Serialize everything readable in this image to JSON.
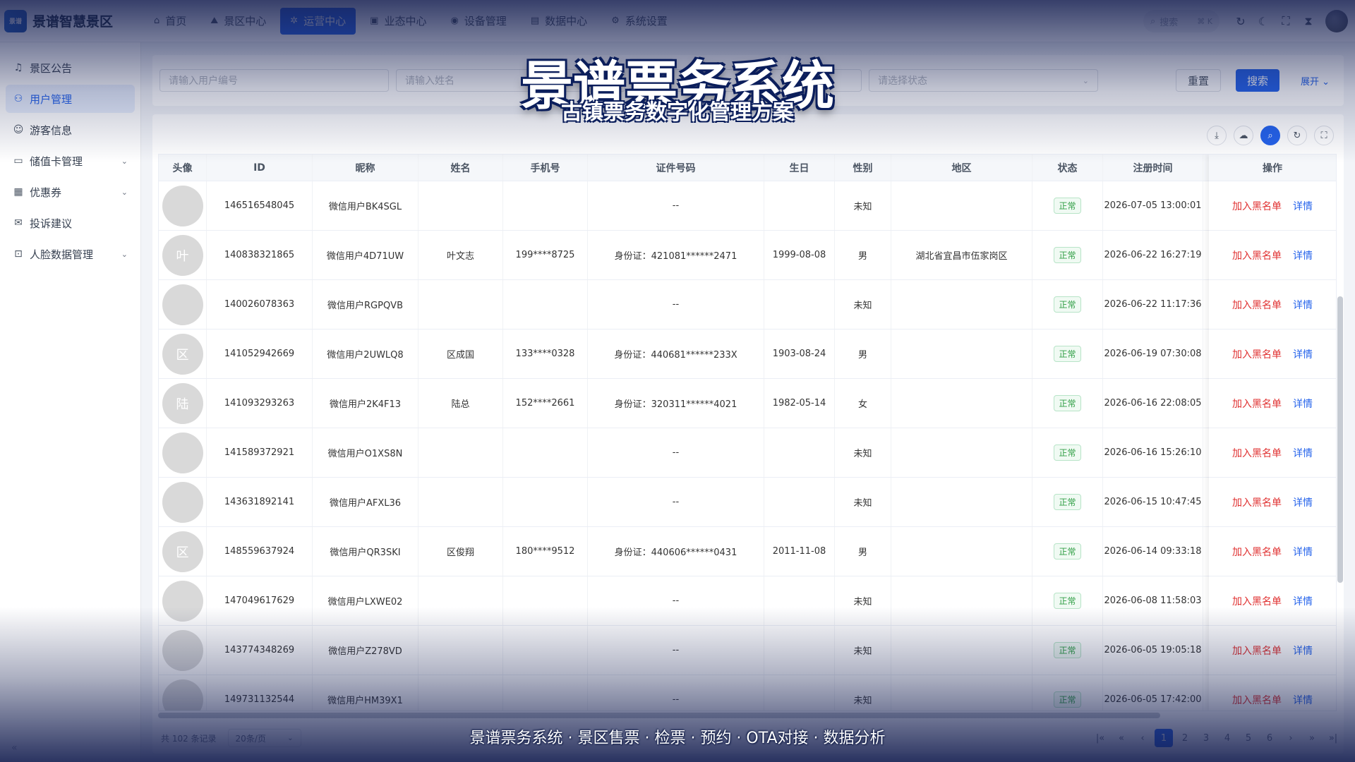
{
  "app": {
    "logo_text": "景谱",
    "title": "景谱智慧景区"
  },
  "nav": {
    "tabs": [
      {
        "label": "首页",
        "icon": "home-icon"
      },
      {
        "label": "景区中心",
        "icon": "landscape-icon"
      },
      {
        "label": "运营中心",
        "icon": "gear-flower-icon"
      },
      {
        "label": "业态中心",
        "icon": "store-icon"
      },
      {
        "label": "设备管理",
        "icon": "device-icon"
      },
      {
        "label": "数据中心",
        "icon": "chart-icon"
      },
      {
        "label": "系统设置",
        "icon": "settings-icon"
      }
    ],
    "active_index": 2
  },
  "top_right": {
    "search_placeholder": "搜索",
    "search_shortcut": "⌘ K"
  },
  "sidebar": {
    "items": [
      {
        "label": "景区公告",
        "icon": "bell-icon"
      },
      {
        "label": "用户管理",
        "icon": "users-icon"
      },
      {
        "label": "游客信息",
        "icon": "user-icon"
      },
      {
        "label": "储值卡管理",
        "icon": "card-icon"
      },
      {
        "label": "优惠券",
        "icon": "ticket-icon"
      },
      {
        "label": "投诉建议",
        "icon": "feedback-icon"
      },
      {
        "label": "人脸数据管理",
        "icon": "face-scan-icon"
      }
    ],
    "active_index": 1
  },
  "filter": {
    "user_id_placeholder": "请输入用户编号",
    "name_placeholder": "请输入姓名",
    "status_placeholder": "请选择状态",
    "reset_label": "重置",
    "search_label": "搜索",
    "expand_label": "展开"
  },
  "table": {
    "columns": [
      "头像",
      "ID",
      "昵称",
      "姓名",
      "手机号",
      "证件号码",
      "生日",
      "性别",
      "地区",
      "状态",
      "注册时间",
      "操作"
    ],
    "rows": [
      {
        "avatar": "",
        "id": "146516548045",
        "nickname": "微信用户BK4SGL",
        "name": "",
        "phone": "",
        "cert": "--",
        "birthday": "",
        "gender": "未知",
        "region": "",
        "status": "正常",
        "registered": "2026-07-05 13:00:01"
      },
      {
        "avatar": "叶",
        "id": "140838321865",
        "nickname": "微信用户4D71UW",
        "name": "叶文志",
        "phone": "199****8725",
        "cert": "身份证：421081******2471",
        "birthday": "1999-08-08",
        "gender": "男",
        "region": "湖北省宜昌市伍家岗区",
        "status": "正常",
        "registered": "2026-06-22 16:27:19"
      },
      {
        "avatar": "",
        "id": "140026078363",
        "nickname": "微信用户RGPQVB",
        "name": "",
        "phone": "",
        "cert": "--",
        "birthday": "",
        "gender": "未知",
        "region": "",
        "status": "正常",
        "registered": "2026-06-22 11:17:36"
      },
      {
        "avatar": "区",
        "id": "141052942669",
        "nickname": "微信用户2UWLQ8",
        "name": "区成国",
        "phone": "133****0328",
        "cert": "身份证：440681******233X",
        "birthday": "1903-08-24",
        "gender": "男",
        "region": "",
        "status": "正常",
        "registered": "2026-06-19 07:30:08"
      },
      {
        "avatar": "陆",
        "id": "141093293263",
        "nickname": "微信用户2K4F13",
        "name": "陆总",
        "phone": "152****2661",
        "cert": "身份证：320311******4021",
        "birthday": "1982-05-14",
        "gender": "女",
        "region": "",
        "status": "正常",
        "registered": "2026-06-16 22:08:05"
      },
      {
        "avatar": "",
        "id": "141589372921",
        "nickname": "微信用户O1XS8N",
        "name": "",
        "phone": "",
        "cert": "--",
        "birthday": "",
        "gender": "未知",
        "region": "",
        "status": "正常",
        "registered": "2026-06-16 15:26:10"
      },
      {
        "avatar": "",
        "id": "143631892141",
        "nickname": "微信用户AFXL36",
        "name": "",
        "phone": "",
        "cert": "--",
        "birthday": "",
        "gender": "未知",
        "region": "",
        "status": "正常",
        "registered": "2026-06-15 10:47:45"
      },
      {
        "avatar": "区",
        "id": "148559637924",
        "nickname": "微信用户QR3SKI",
        "name": "区俊翔",
        "phone": "180****9512",
        "cert": "身份证：440606******0431",
        "birthday": "2011-11-08",
        "gender": "男",
        "region": "",
        "status": "正常",
        "registered": "2026-06-14 09:33:18"
      },
      {
        "avatar": "",
        "id": "147049617629",
        "nickname": "微信用户LXWE02",
        "name": "",
        "phone": "",
        "cert": "--",
        "birthday": "",
        "gender": "未知",
        "region": "",
        "status": "正常",
        "registered": "2026-06-08 11:58:03"
      },
      {
        "avatar": "",
        "id": "143774348269",
        "nickname": "微信用户Z278VD",
        "name": "",
        "phone": "",
        "cert": "--",
        "birthday": "",
        "gender": "未知",
        "region": "",
        "status": "正常",
        "registered": "2026-06-05 19:05:18"
      },
      {
        "avatar": "",
        "id": "149731132544",
        "nickname": "微信用户HM39X1",
        "name": "",
        "phone": "",
        "cert": "--",
        "birthday": "",
        "gender": "未知",
        "region": "",
        "status": "正常",
        "registered": "2026-06-05 17:42:00"
      }
    ],
    "op_blacklist_label": "加入黑名单",
    "op_detail_label": "详情"
  },
  "footer": {
    "total_text": "共 102 条记录",
    "page_size": "20条/页",
    "pages": [
      "1",
      "2",
      "3",
      "4",
      "5",
      "6"
    ],
    "current_page": "1"
  },
  "overlay": {
    "title": "景谱票务系统",
    "subtitle": "古镇票务数字化管理方案",
    "bottom_caption": "景谱票务系统 · 景区售票 · 检票 · 预约 · OTA对接 · 数据分析"
  },
  "colors": {
    "primary": "#2563eb",
    "danger": "#e03131",
    "success": "#2f9e44"
  }
}
